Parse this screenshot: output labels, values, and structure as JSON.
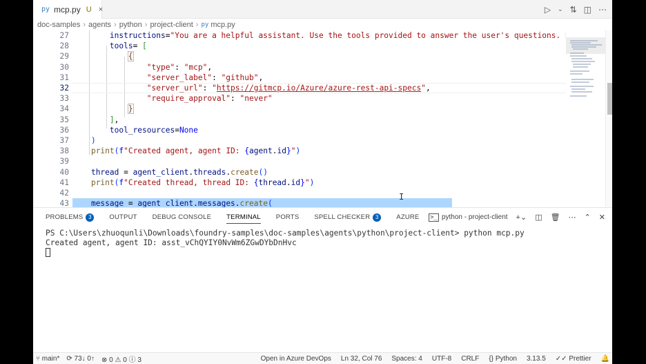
{
  "tab": {
    "icon": "py",
    "name": "mcp.py",
    "status": "U",
    "close": "×"
  },
  "editor_actions": [
    "run-icon",
    "chevron-down-icon",
    "compare-icon",
    "split-editor-icon",
    "more-icon"
  ],
  "breadcrumb": [
    "doc-samples",
    "agents",
    "python",
    "project-client",
    "mcp.py"
  ],
  "code_lines": [
    {
      "n": "27",
      "text": "        instructions=\"You are a helpful assistant. Use the tools provided to answer the user's questions. Be sur"
    },
    {
      "n": "28",
      "text": "        tools= ["
    },
    {
      "n": "29",
      "text": "            {"
    },
    {
      "n": "30",
      "text": "                \"type\": \"mcp\","
    },
    {
      "n": "31",
      "text": "                \"server_label\": \"github\","
    },
    {
      "n": "32",
      "text": "                \"server_url\": \"https://gitmcp.io/Azure/azure-rest-api-specs\","
    },
    {
      "n": "33",
      "text": "                \"require_approval\": \"never\""
    },
    {
      "n": "34",
      "text": "            }"
    },
    {
      "n": "35",
      "text": "        ],"
    },
    {
      "n": "36",
      "text": "        tool_resources=None"
    },
    {
      "n": "37",
      "text": "    )"
    },
    {
      "n": "38",
      "text": "    print(f\"Created agent, agent ID: {agent.id}\")"
    },
    {
      "n": "39",
      "text": ""
    },
    {
      "n": "40",
      "text": "    thread = agent_client.threads.create()"
    },
    {
      "n": "41",
      "text": "    print(f\"Created thread, thread ID: {thread.id}\")"
    },
    {
      "n": "42",
      "text": ""
    },
    {
      "n": "43",
      "text": "    message = agent_client.messages.create("
    }
  ],
  "panel": {
    "tabs": [
      {
        "label": "PROBLEMS",
        "badge": "3"
      },
      {
        "label": "OUTPUT",
        "badge": ""
      },
      {
        "label": "DEBUG CONSOLE",
        "badge": ""
      },
      {
        "label": "TERMINAL",
        "badge": ""
      },
      {
        "label": "PORTS",
        "badge": ""
      },
      {
        "label": "SPELL CHECKER",
        "badge": "3"
      },
      {
        "label": "AZURE",
        "badge": ""
      }
    ],
    "terminal_name": "python - project-client",
    "terminal_lines": [
      "PS C:\\Users\\zhuoqunli\\Downloads\\foundry-samples\\doc-samples\\agents\\python\\project-client> python mcp.py",
      "Created agent, agent ID: asst_vChQYIY0NvWm6ZGwDYbDnHvc"
    ]
  },
  "status": {
    "branch": "main*",
    "sync": "73↓ 0↑",
    "errors": "0",
    "warnings": "0",
    "info": "3",
    "open_in": "Open in Azure DevOps",
    "position": "Ln 32, Col 76",
    "spaces": "Spaces: 4",
    "encoding": "UTF-8",
    "eol": "CRLF",
    "language": "Python",
    "version": "3.13.5",
    "formatter": "Prettier"
  }
}
